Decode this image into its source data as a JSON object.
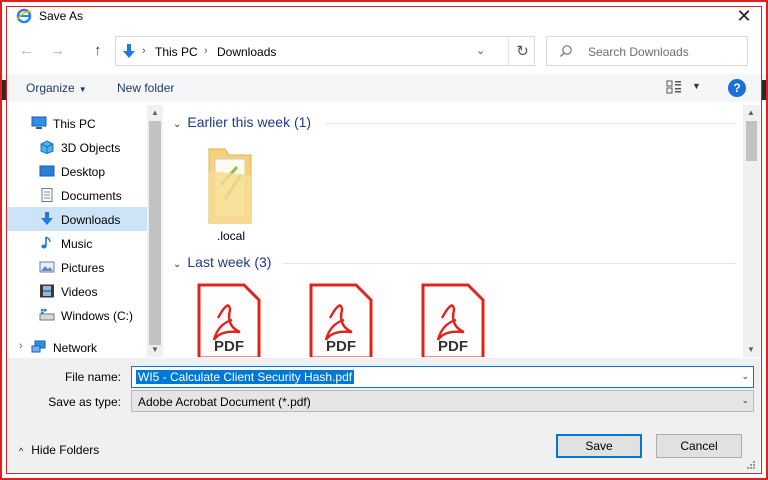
{
  "window": {
    "title": "Save As",
    "close_glyph": "✕",
    "icon": "internet-explorer-icon"
  },
  "nav": {
    "back_glyph": "←",
    "forward_glyph": "→",
    "up_glyph": "↑",
    "breadcrumb": [
      {
        "label": "This PC"
      },
      {
        "label": "Downloads"
      }
    ],
    "separator_glyph": "›",
    "dropdown_glyph": "⌄",
    "refresh_glyph": "↻",
    "search_placeholder": "Search Downloads"
  },
  "toolbar": {
    "organize_label": "Organize",
    "organize_caret": "▼",
    "new_folder_label": "New folder",
    "view_caret": "▼",
    "help_label": "?"
  },
  "sidebar": {
    "items": [
      {
        "label": "This PC",
        "icon": "pc-icon"
      },
      {
        "label": "3D Objects",
        "icon": "cube-icon"
      },
      {
        "label": "Desktop",
        "icon": "desktop-icon"
      },
      {
        "label": "Documents",
        "icon": "documents-icon"
      },
      {
        "label": "Downloads",
        "icon": "download-arrow-icon",
        "selected": true
      },
      {
        "label": "Music",
        "icon": "music-note-icon"
      },
      {
        "label": "Pictures",
        "icon": "pictures-icon"
      },
      {
        "label": "Videos",
        "icon": "film-icon"
      },
      {
        "label": "Windows (C:)",
        "icon": "drive-icon"
      },
      {
        "label": "Network",
        "icon": "network-icon"
      }
    ],
    "expand_glyph": "›"
  },
  "content": {
    "groups": [
      {
        "label": "Earlier this week (1)",
        "files": [
          {
            "name": ".local",
            "type": "folder"
          }
        ]
      },
      {
        "label": "Last week (3)",
        "files": [
          {
            "name": "",
            "type": "pdf",
            "badge": "PDF"
          },
          {
            "name": "",
            "type": "pdf",
            "badge": "PDF"
          },
          {
            "name": "",
            "type": "pdf",
            "badge": "PDF"
          }
        ]
      }
    ],
    "collapse_glyph": "⌄"
  },
  "form": {
    "file_name_label": "File name:",
    "file_name_value": "WI5 - Calculate Client Security Hash.pdf",
    "save_as_type_label": "Save as type:",
    "save_as_type_value": "Adobe Acrobat Document (*.pdf)",
    "dropdown_glyph": "⌄"
  },
  "footer": {
    "hide_folders_label": "Hide Folders",
    "hide_folders_glyph": "^",
    "save_label": "Save",
    "cancel_label": "Cancel"
  },
  "colors": {
    "accent": "#0078d7",
    "frame_highlight": "#e02020",
    "group_header": "#1e3a8a",
    "pdf_red": "#e0231b"
  }
}
